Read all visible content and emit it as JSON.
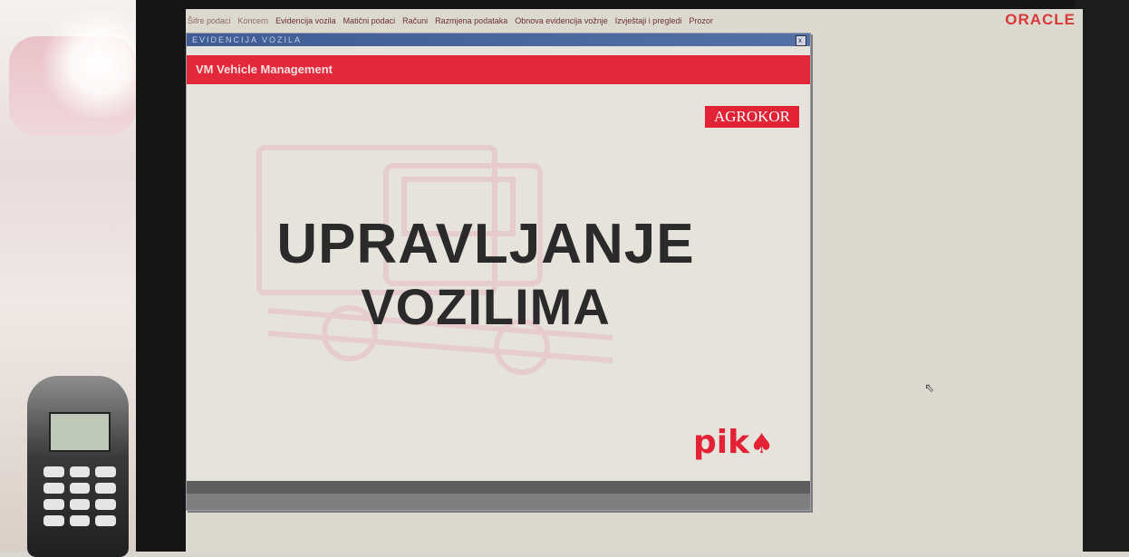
{
  "menu": {
    "items": [
      "Šifre podaci",
      "Koncern",
      "Evidencija vozila",
      "Matični podaci",
      "Računi",
      "Razmjena podataka",
      "Obnova evidencija vožnje",
      "Izvještaji i pregledi",
      "Prozor"
    ]
  },
  "brand": "ORACLE",
  "window": {
    "title": "EVIDENCIJA VOZILA",
    "close_label": "x",
    "header": "VM Vehicle Management",
    "company_logo": "AGROKOR",
    "headline_line1": "UPRAVLJANJE",
    "headline_line2": "VOZILIMA",
    "footer_logo": "pik"
  },
  "status": {
    "fields": [
      "",
      "",
      "",
      ""
    ]
  },
  "colors": {
    "accent_red": "#e2283a",
    "title_blue": "#3f5c94",
    "oracle_red": "#d83a3a"
  }
}
